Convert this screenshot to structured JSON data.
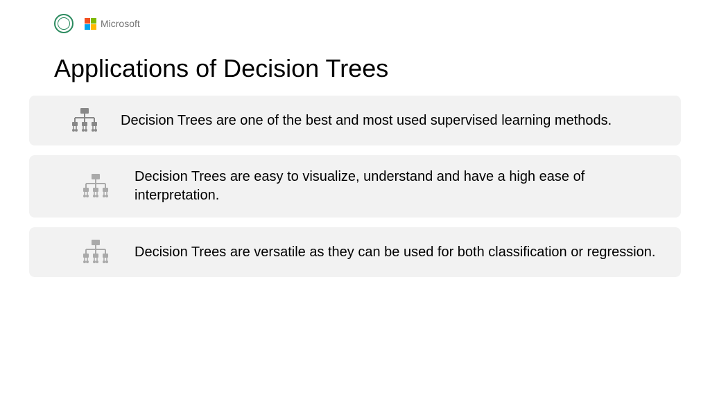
{
  "header": {
    "microsoft_text": "Microsoft"
  },
  "title": "Applications of Decision Trees",
  "points": [
    {
      "text": "Decision Trees are one of the best and most used supervised learning methods."
    },
    {
      "text": "Decision Trees are easy to visualize, understand and have a high ease of interpretation."
    },
    {
      "text": "Decision Trees are versatile as they can be used for both classification or regression."
    }
  ]
}
